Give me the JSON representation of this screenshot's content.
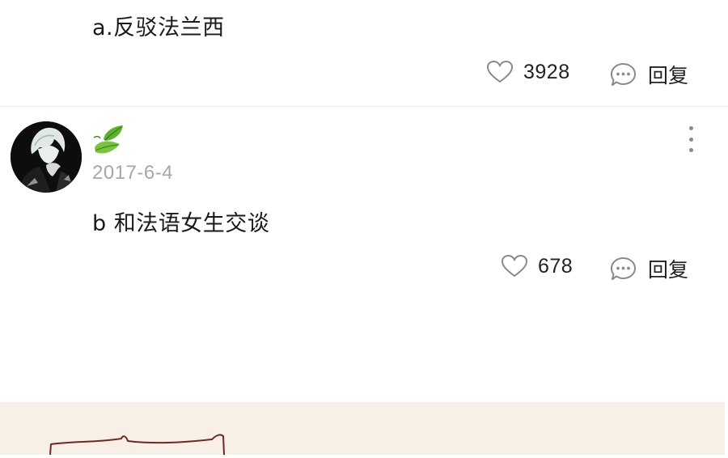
{
  "comments": [
    {
      "text": "a.反驳法兰西",
      "likes": "3928",
      "reply_label": "回复"
    },
    {
      "username_icon": "leaf-emoji",
      "date": "2017-6-4",
      "text": "b 和法语女生交谈",
      "likes": "678",
      "reply_label": "回复"
    }
  ],
  "colors": {
    "background": "#ffffff",
    "date_gray": "#a7a7a7",
    "icon_gray": "#8a8a8a",
    "peach_panel": "#f8efe6",
    "sketch_stroke": "#6b2a22"
  }
}
